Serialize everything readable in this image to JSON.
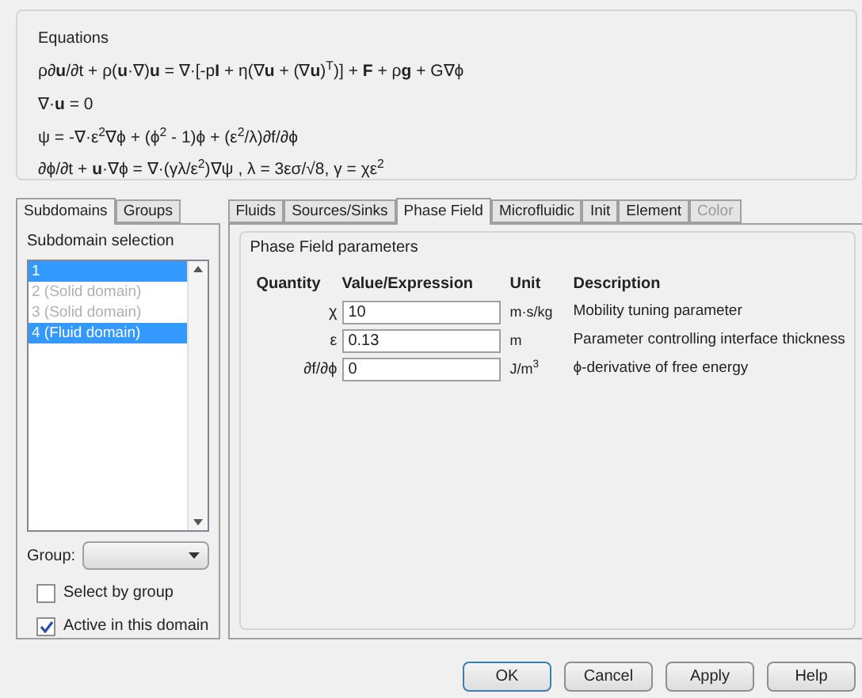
{
  "equations": {
    "title": "Equations",
    "lines": [
      "ρ∂**u**/∂t + ρ(**u**·∇)**u** = ∇·[-p**I** + η(∇**u** + (∇**u**)$^{T}$)] + **F** + ρ**g** + G∇ϕ",
      "∇·**u** = 0",
      "ψ = -∇·ε$^{2}$∇ϕ + (ϕ$^{2}$ - 1)ϕ + (ε$^{2}$/λ)∂f/∂ϕ",
      "∂ϕ/∂t + **u**·∇ϕ = ∇·(γλ/ε$^{2}$)∇ψ , λ = 3εσ/√8, γ = χε$^{2}$"
    ]
  },
  "left_tabs": [
    {
      "label": "Subdomains",
      "selected": true
    },
    {
      "label": "Groups",
      "selected": false
    }
  ],
  "subdomain_selection": {
    "title": "Subdomain selection",
    "items": [
      {
        "label": "1",
        "selected": true,
        "disabled": false
      },
      {
        "label": "2 (Solid domain)",
        "selected": false,
        "disabled": true
      },
      {
        "label": "3 (Solid domain)",
        "selected": false,
        "disabled": true
      },
      {
        "label": "4 (Fluid domain)",
        "selected": true,
        "disabled": false
      }
    ]
  },
  "group": {
    "label": "Group:"
  },
  "checkboxes": [
    {
      "label": "Select by group",
      "checked": false
    },
    {
      "label": "Active in this domain",
      "checked": true
    }
  ],
  "right_tabs": [
    {
      "label": "Fluids",
      "selected": false,
      "disabled": false
    },
    {
      "label": "Sources/Sinks",
      "selected": false,
      "disabled": false
    },
    {
      "label": "Phase Field",
      "selected": true,
      "disabled": false
    },
    {
      "label": "Microfluidic",
      "selected": false,
      "disabled": false
    },
    {
      "label": "Init",
      "selected": false,
      "disabled": false
    },
    {
      "label": "Element",
      "selected": false,
      "disabled": false
    },
    {
      "label": "Color",
      "selected": false,
      "disabled": true
    }
  ],
  "parameters": {
    "title": "Phase Field parameters",
    "columns": [
      "Quantity",
      "Value/Expression",
      "Unit",
      "Description"
    ],
    "rows": [
      {
        "quantity": "χ",
        "value": "10",
        "unit": "m·s/kg",
        "description": "Mobility tuning parameter"
      },
      {
        "quantity": "ε",
        "value": "0.13",
        "unit": "m",
        "description": "Parameter controlling interface thickness"
      },
      {
        "quantity": "∂f/∂ϕ",
        "value": "0",
        "unit": "J/m$^{3}$",
        "description": "ϕ-derivative of free energy"
      }
    ]
  },
  "buttons": [
    "OK",
    "Cancel",
    "Apply",
    "Help"
  ]
}
